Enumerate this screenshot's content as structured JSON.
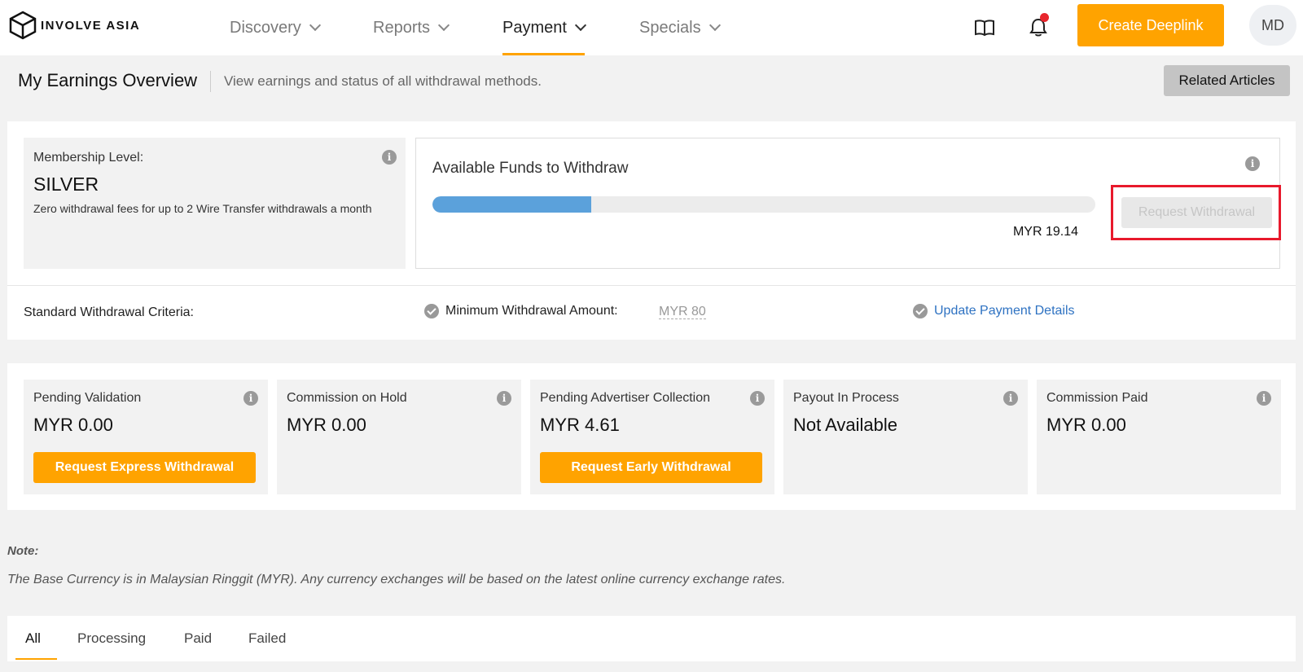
{
  "brand": {
    "name": "INVOLVE ASIA"
  },
  "nav": {
    "items": [
      {
        "label": "Discovery"
      },
      {
        "label": "Reports"
      },
      {
        "label": "Payment"
      },
      {
        "label": "Specials"
      }
    ],
    "active": "Payment",
    "icons": [
      "book-icon",
      "bell-icon"
    ],
    "create_label": "Create Deeplink",
    "avatar_initials": "MD"
  },
  "header": {
    "title": "My Earnings Overview",
    "subtitle": "View earnings and status of all withdrawal methods.",
    "related_label": "Related Articles"
  },
  "membership": {
    "label": "Membership Level:",
    "level": "SILVER",
    "description": "Zero withdrawal fees for up to 2 Wire Transfer withdrawals a month"
  },
  "funds": {
    "title": "Available Funds to Withdraw",
    "amount": "MYR 19.14",
    "progress_fraction": 0.24,
    "withdraw_label": "Request Withdrawal"
  },
  "criteria": {
    "label": "Standard Withdrawal Criteria:",
    "min_label": "Minimum Withdrawal Amount:",
    "min_value": "MYR 80",
    "update_label": "Update Payment Details"
  },
  "stats": [
    {
      "label": "Pending Validation",
      "value": "MYR 0.00",
      "button": "Request Express Withdrawal"
    },
    {
      "label": "Commission on Hold",
      "value": "MYR 0.00"
    },
    {
      "label": "Pending Advertiser Collection",
      "value": "MYR 4.61",
      "button": "Request Early Withdrawal"
    },
    {
      "label": "Payout In Process",
      "value": "Not Available"
    },
    {
      "label": "Commission Paid",
      "value": "MYR 0.00"
    }
  ],
  "note": {
    "title": "Note:",
    "text": "The Base Currency is in Malaysian Ringgit (MYR). Any currency exchanges will be based on the latest online currency exchange rates."
  },
  "tabs": [
    {
      "label": "All"
    },
    {
      "label": "Processing"
    },
    {
      "label": "Paid"
    },
    {
      "label": "Failed"
    }
  ],
  "colors": {
    "accent": "#ffa300",
    "progress": "#5ba1db",
    "link": "#2e72c2",
    "highlight": "#e8192c"
  }
}
